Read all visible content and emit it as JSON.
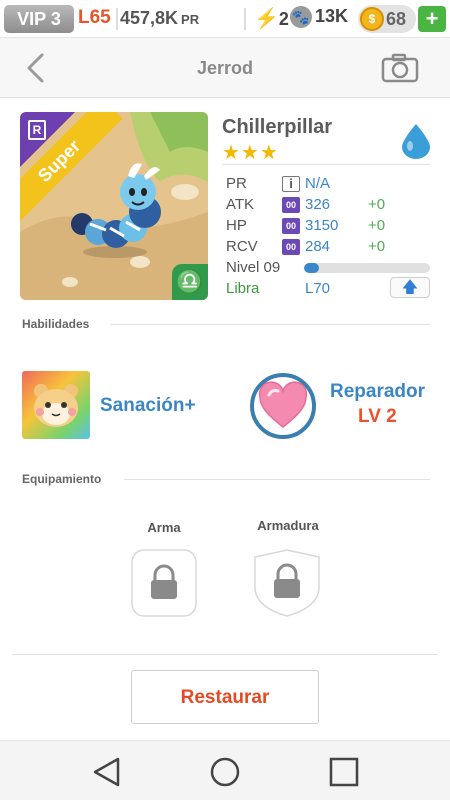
{
  "status": {
    "vip": "VIP 3",
    "level": "L65",
    "power": "457,8K",
    "power_unit": "PR",
    "energy": "2",
    "paws": "13K",
    "coins": "68",
    "add": "+"
  },
  "header": {
    "title": "Jerrod"
  },
  "monster": {
    "rarity_badge": "R",
    "ribbon": "Super",
    "zodiac_symbol": "♎",
    "name": "Chillerpillar",
    "stars": "★★★",
    "element_color": "#3a9fd8",
    "stats": {
      "pr_label": "PR",
      "pr_value": "N/A",
      "atk_label": "ATK",
      "atk_icon": "00",
      "atk_value": "326",
      "atk_bonus": "+0",
      "hp_label": "HP",
      "hp_icon": "00",
      "hp_value": "3150",
      "hp_bonus": "+0",
      "rcv_label": "RCV",
      "rcv_icon": "00",
      "rcv_value": "284",
      "rcv_bonus": "+0",
      "level_label": "Nivel 09",
      "level_progress": 0.12,
      "sign_label": "Libra",
      "sign_level": "L70",
      "upgrade_icon": "up-arrow-icon"
    }
  },
  "abilities": {
    "title": "Habilidades",
    "skill_name": "Sanación+",
    "passive_name": "Reparador",
    "passive_level": "LV 2"
  },
  "equipment": {
    "title": "Equipamiento",
    "weapon_label": "Arma",
    "armor_label": "Armadura"
  },
  "actions": {
    "restore_label": "Restaurar"
  },
  "colors": {
    "accent_blue": "#3a86c8",
    "accent_orange": "#e44b25",
    "accent_green": "#4caf50",
    "ribbon_yellow": "#f3c21b",
    "rarity_purple": "#6e3fb0"
  }
}
